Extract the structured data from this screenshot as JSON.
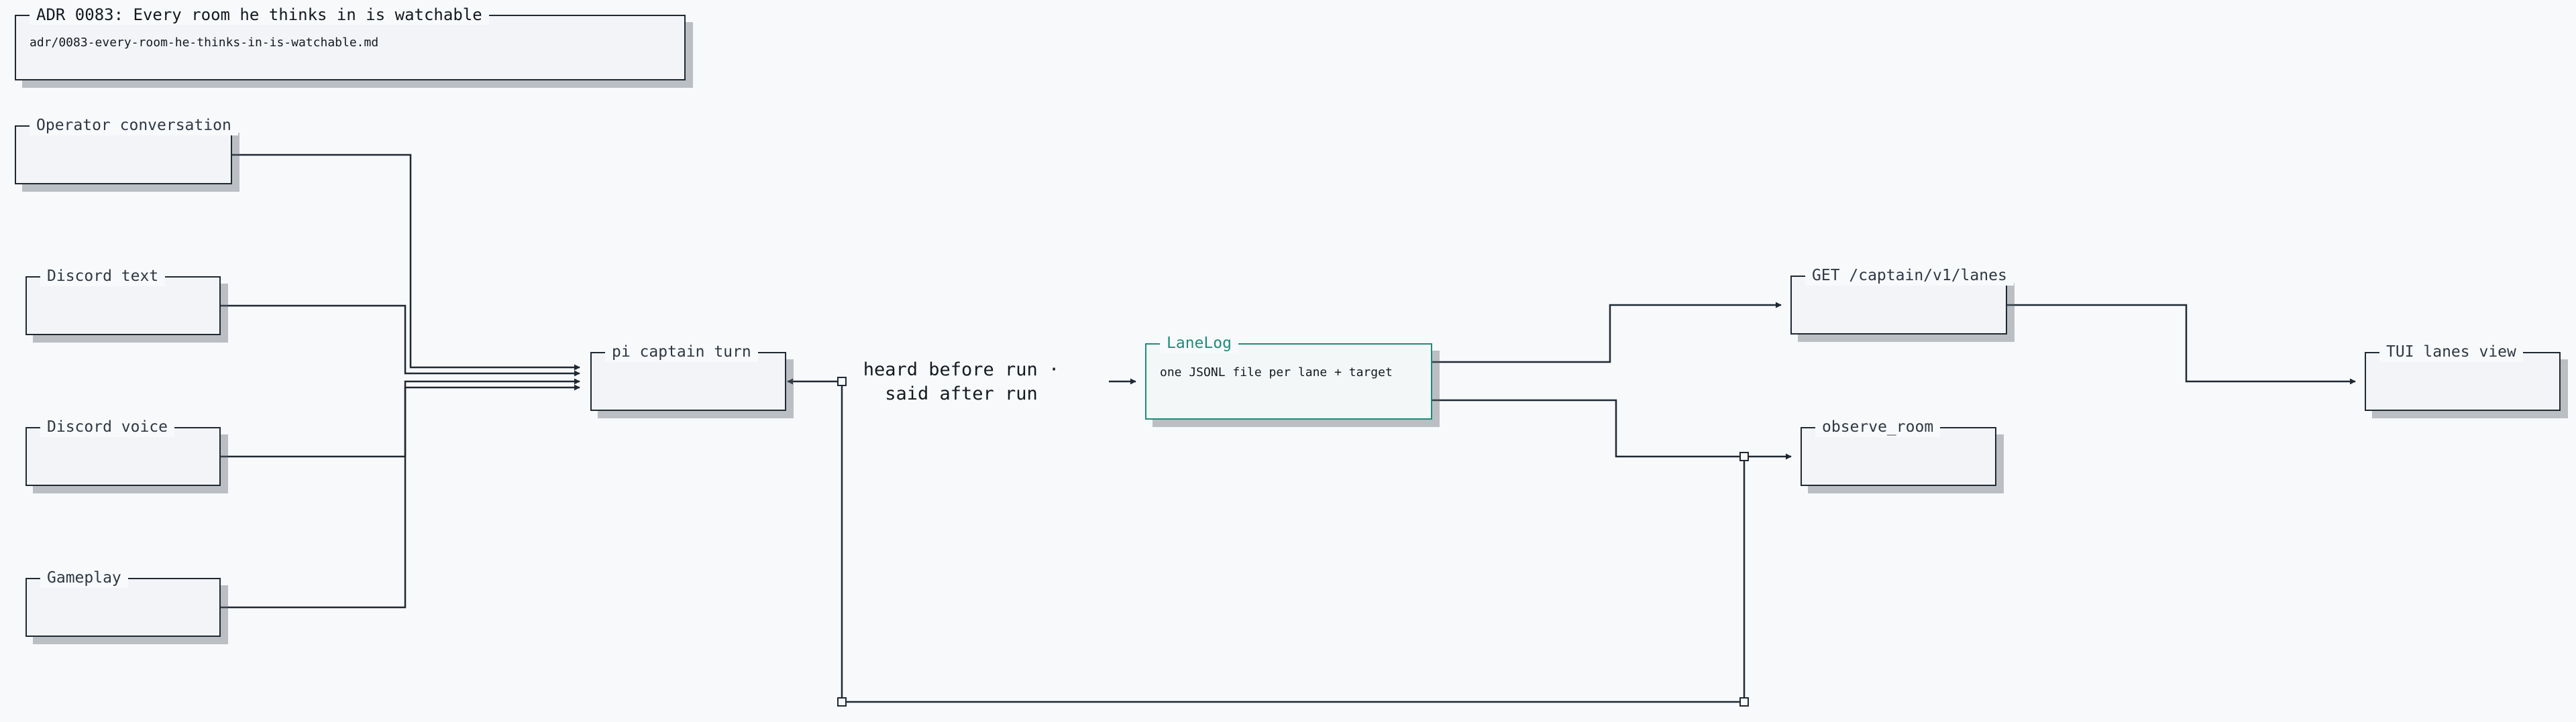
{
  "diagram": {
    "adr": {
      "title": "ADR 0083: Every room he thinks in is watchable",
      "path": "adr/0083-every-room-he-thinks-in-is-watchable.md"
    },
    "nodes": {
      "operator_conversation": {
        "title": "Operator conversation"
      },
      "discord_text": {
        "title": "Discord text"
      },
      "discord_voice": {
        "title": "Discord voice"
      },
      "gameplay": {
        "title": "Gameplay"
      },
      "captain_turn": {
        "title": "pi captain turn"
      },
      "lanelog": {
        "title": "LaneLog",
        "body": "one JSONL file per lane + target"
      },
      "lanes_endpoint": {
        "title": "GET /captain/v1/lanes"
      },
      "observe_room": {
        "title": "observe_room"
      },
      "tui_view": {
        "title": "TUI lanes view"
      }
    },
    "edge_label": "heard before run · said after run",
    "colors": {
      "line": "#1f2933",
      "accent": "#1e8c7a",
      "background": "#f7f9fb"
    }
  }
}
